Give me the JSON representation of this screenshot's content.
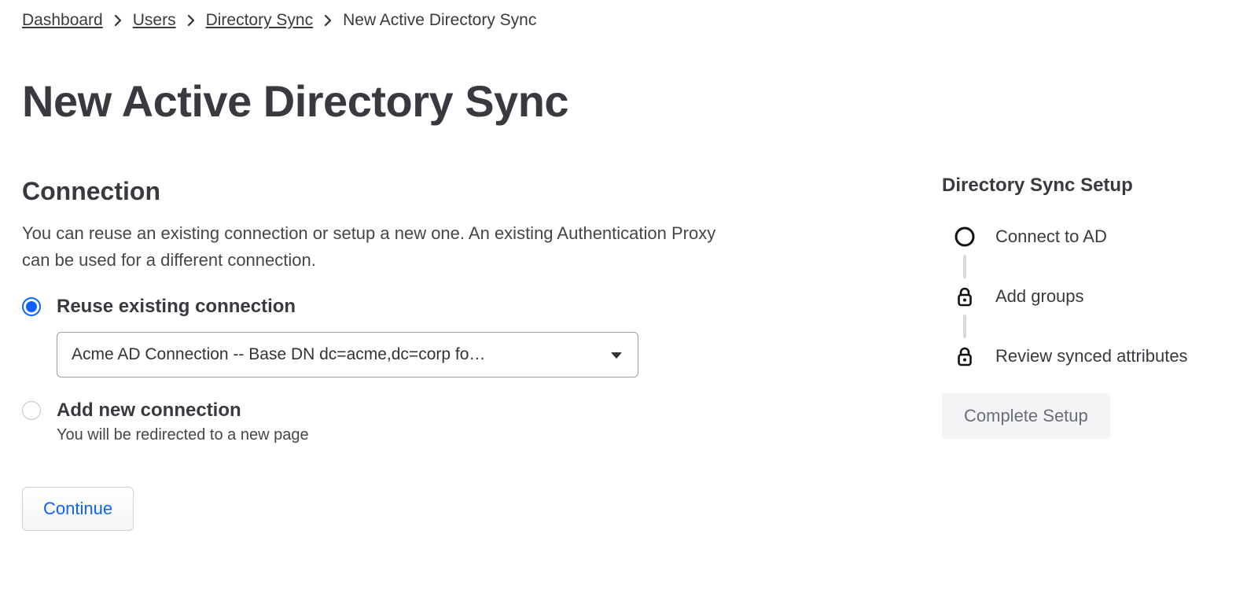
{
  "breadcrumb": {
    "items": [
      {
        "label": "Dashboard",
        "link": true
      },
      {
        "label": "Users",
        "link": true
      },
      {
        "label": "Directory Sync",
        "link": true
      },
      {
        "label": "New Active Directory Sync",
        "link": false
      }
    ]
  },
  "page": {
    "title": "New Active Directory Sync"
  },
  "connection": {
    "section_title": "Connection",
    "description": "You can reuse an existing connection or setup a new one. An existing Authentication Proxy can be used for a different connection.",
    "options": {
      "reuse": {
        "label": "Reuse existing connection",
        "selected": true,
        "select_value": "Acme AD Connection -- Base DN dc=acme,dc=corp fo…"
      },
      "add_new": {
        "label": "Add new connection",
        "sub": "You will be redirected to a new page",
        "selected": false
      }
    },
    "continue_label": "Continue"
  },
  "stepper": {
    "title": "Directory Sync Setup",
    "steps": [
      {
        "label": "Connect to AD",
        "state": "current"
      },
      {
        "label": "Add groups",
        "state": "locked"
      },
      {
        "label": "Review synced attributes",
        "state": "locked"
      }
    ],
    "complete_label": "Complete Setup"
  }
}
